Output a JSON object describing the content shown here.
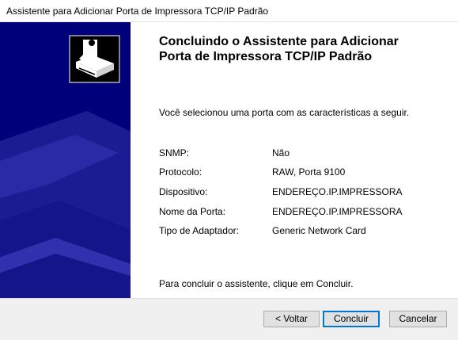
{
  "window": {
    "title": "Assistente para Adicionar Porta de Impressora TCP/IP Padrão"
  },
  "heading": {
    "line1": "Concluindo o Assistente para Adicionar",
    "line2": "Porta de Impressora TCP/IP Padrão"
  },
  "intro": "Você selecionou uma porta com as características a seguir.",
  "details": [
    {
      "label": "SNMP:",
      "value": "Não"
    },
    {
      "label": "Protocolo:",
      "value": "RAW, Porta 9100"
    },
    {
      "label": "Dispositivo:",
      "value": "ENDEREÇO.IP.IMPRESSORA"
    },
    {
      "label": "Nome da Porta:",
      "value": "ENDEREÇO.IP.IMPRESSORA"
    },
    {
      "label": "Tipo de Adaptador:",
      "value": "Generic Network Card"
    }
  ],
  "outro": "Para concluir o assistente, clique em Concluir.",
  "buttons": {
    "back": "< Voltar",
    "finish": "Concluir",
    "cancel": "Cancelar"
  },
  "colors": {
    "banner": "#00007b",
    "accent": "#0078d7"
  },
  "icons": {
    "wizard": "printer-wizard-icon"
  }
}
